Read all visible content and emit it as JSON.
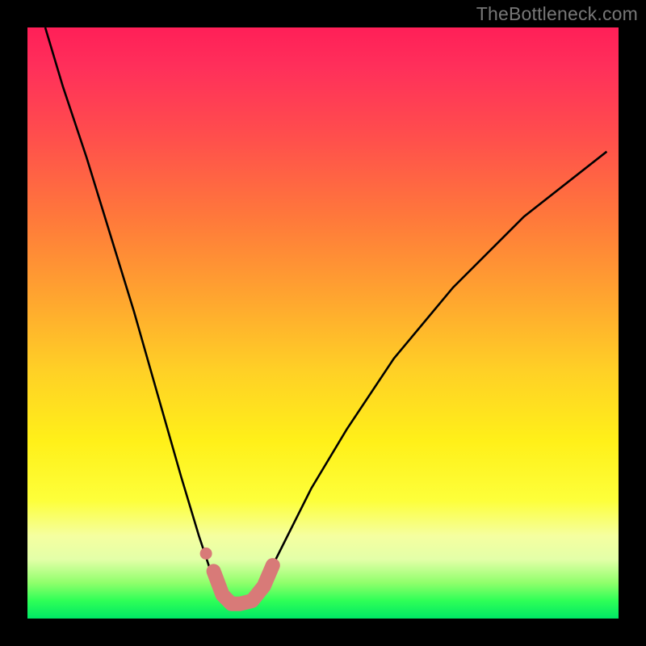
{
  "watermark": "TheBottleneck.com",
  "chart_data": {
    "type": "line",
    "title": "",
    "xlabel": "",
    "ylabel": "",
    "xlim": [
      0,
      100
    ],
    "ylim": [
      0,
      100
    ],
    "grid": false,
    "legend": false,
    "series": [
      {
        "name": "bottleneck-curve",
        "color": "#000000",
        "x": [
          3,
          6,
          10,
          14,
          18,
          22,
          26,
          29,
          31,
          33,
          34.5,
          36,
          39,
          41,
          44,
          48,
          54,
          62,
          72,
          84,
          98
        ],
        "y": [
          100,
          90,
          78,
          65,
          52,
          38,
          24,
          14,
          8,
          4,
          2.5,
          2.5,
          4,
          8,
          14,
          22,
          32,
          44,
          56,
          68,
          79
        ]
      },
      {
        "name": "highlight-band",
        "color": "#d87a78",
        "x": [
          31.5,
          33,
          34.5,
          36,
          38,
          40,
          41.5
        ],
        "y": [
          8,
          4,
          2.5,
          2.5,
          3,
          5.5,
          9
        ]
      },
      {
        "name": "highlight-dot",
        "color": "#d87a78",
        "x": [
          30.2
        ],
        "y": [
          11
        ]
      }
    ]
  }
}
